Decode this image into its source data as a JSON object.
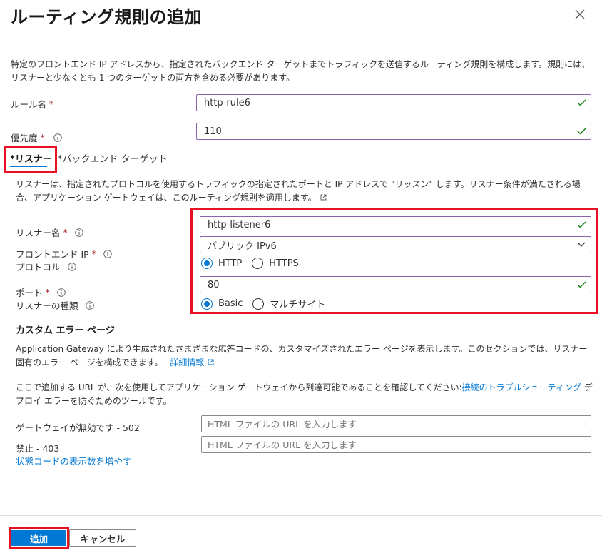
{
  "header": {
    "title": "ルーティング規則の追加"
  },
  "intro": {
    "text": "特定のフロントエンド IP アドレスから、指定されたバックエンド ターゲットまでトラフィックを送信するルーティング規則を構成します。規則には、リスナーと少なくとも 1 つのターゲットの両方を含める必要があります。"
  },
  "rule": {
    "name_label": "ルール名",
    "name_value": "http-rule6",
    "priority_label": "優先度",
    "priority_value": "110",
    "required_mark": "*"
  },
  "tabs": [
    {
      "label": "リスナー",
      "required_mark": "*"
    },
    {
      "label": "バックエンド ターゲット",
      "required_mark": "*"
    }
  ],
  "listener": {
    "description": "リスナーは、指定されたプロトコルを使用するトラフィックの指定されたポートと IP アドレスで \"リッスン\" します。リスナー条件が満たされる場合、アプリケーション ゲートウェイは、このルーティング規則を適用します。",
    "name_label": "リスナー名",
    "name_value": "http-listener6",
    "frontend_ip_label": "フロントエンド IP",
    "frontend_ip_value": "パブリック IPv6",
    "protocol_label": "プロトコル",
    "protocol_options": [
      "HTTP",
      "HTTPS"
    ],
    "protocol_selected": "HTTP",
    "port_label": "ポート",
    "port_value": "80",
    "type_label": "リスナーの種類",
    "type_options": [
      "Basic",
      "マルチサイト"
    ],
    "type_selected": "Basic"
  },
  "custom_error": {
    "heading": "カスタム エラー ページ",
    "description": "Application Gateway により生成されたさまざまな応答コードの、カスタマイズされたエラー ページを表示します。このセクションでは、リスナー固有のエラー ページを構成できます。",
    "learn_more": "詳細情報",
    "url_note_before": "ここで追加する URL が、次を使用してアプリケーション ゲートウェイから到達可能であることを確認してください:",
    "url_note_link": "接続のトラブルシューティング",
    "url_note_after": " デプロイ エラーを防ぐためのツールです。",
    "rows": [
      {
        "label": "ゲートウェイが無効です - 502",
        "placeholder": "HTML ファイルの URL を入力します"
      },
      {
        "label": "禁止 - 403",
        "placeholder": "HTML ファイルの URL を入力します"
      }
    ],
    "show_more": "状態コードの表示数を増やす"
  },
  "footer": {
    "add_label": "追加",
    "cancel_label": "キャンセル"
  },
  "colors": {
    "accent": "#0078d4",
    "highlight": "#e81123",
    "valid": "#107c10"
  }
}
